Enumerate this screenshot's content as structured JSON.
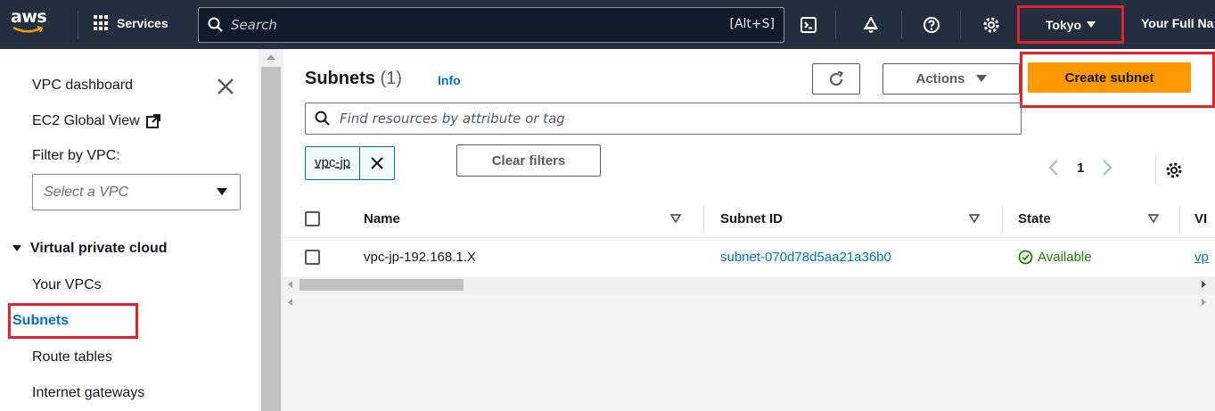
{
  "nav": {
    "logo_text": "aws",
    "services_label": "Services",
    "search_placeholder": "Search",
    "search_shortcut": "[Alt+S]",
    "region_label": "Tokyo",
    "user_label": "Your Full Na"
  },
  "sidebar": {
    "dashboard": "VPC dashboard",
    "ec2_global": "EC2 Global View",
    "filter_label": "Filter by VPC:",
    "select_placeholder": "Select a VPC",
    "section_title": "Virtual private cloud",
    "items": [
      {
        "label": "Your VPCs"
      },
      {
        "label": "Subnets"
      },
      {
        "label": "Route tables"
      },
      {
        "label": "Internet gateways"
      }
    ]
  },
  "main": {
    "title": "Subnets",
    "count": "(1)",
    "info": "Info",
    "actions_label": "Actions",
    "create_label": "Create subnet",
    "filter_placeholder": "Find resources by attribute or tag",
    "token_label": "vpc-jp",
    "clear_label": "Clear filters",
    "page_number": "1",
    "columns": [
      "Name",
      "Subnet ID",
      "State",
      "VI"
    ],
    "rows": [
      {
        "name": "vpc-jp-192.168.1.X",
        "subnet_id": "subnet-070d78d5aa21a36b0",
        "state": "Available",
        "vpc": "vp"
      }
    ]
  },
  "colors": {
    "nav_bg": "#232f3e",
    "accent_orange": "#ff9900",
    "link_blue": "#0073bb",
    "success_green": "#1d8102",
    "highlight_red": "#e5212b"
  }
}
